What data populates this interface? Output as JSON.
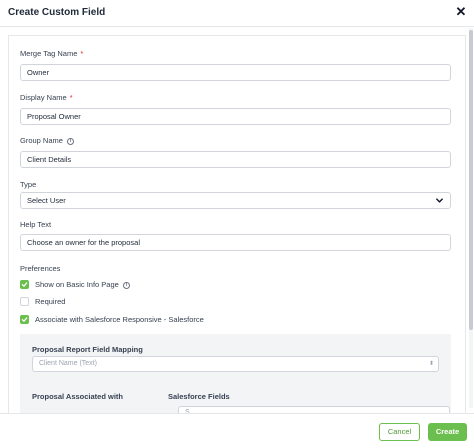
{
  "modal": {
    "title": "Create Custom Field",
    "close_glyph": "✕"
  },
  "form": {
    "merge_tag": {
      "label": "Merge Tag Name",
      "required_mark": "*",
      "value": "Owner"
    },
    "display_name": {
      "label": "Display Name",
      "required_mark": "*",
      "value": "Proposal Owner"
    },
    "group_name": {
      "label": "Group Name",
      "value": "Client Details",
      "info_glyph": "i"
    },
    "type": {
      "label": "Type",
      "value": "Select User"
    },
    "help_text": {
      "label": "Help Text",
      "value": "Choose an owner for the proposal"
    },
    "preferences": {
      "label": "Preferences",
      "options": [
        {
          "label": "Show on Basic Info Page",
          "checked": true,
          "has_info": true
        },
        {
          "label": "Required",
          "checked": false,
          "has_info": false
        },
        {
          "label": "Associate with Salesforce Responsive - Salesforce",
          "checked": true,
          "has_info": false
        }
      ]
    },
    "salesforce_panel": {
      "mapping_label": "Proposal Report Field Mapping",
      "mapping_placeholder": "Client Name (Text)",
      "associated_label": "Proposal Associated with",
      "fields_label": "Salesforce Fields",
      "fields_partial_text": "S"
    }
  },
  "footer": {
    "cancel_label": "Cancel",
    "create_label": "Create"
  },
  "colors": {
    "accent": "#6bbf4e",
    "required": "#dc2626"
  }
}
